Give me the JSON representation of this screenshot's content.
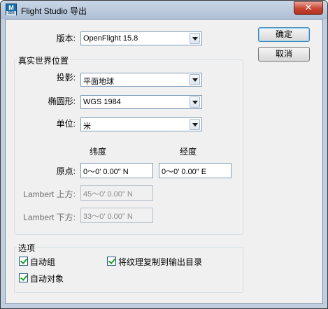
{
  "window": {
    "title": "Flight Studio 导出",
    "icon_text": "M",
    "icon_sub": "3DS",
    "close_glyph": "✕"
  },
  "version": {
    "label": "版本:",
    "value": "OpenFlight 15.8"
  },
  "buttons": {
    "ok": "确定",
    "cancel": "取消"
  },
  "real_world": {
    "title": "真实世界位置",
    "projection": {
      "label": "投影:",
      "value": "平面地球"
    },
    "ellipsoid": {
      "label": "椭圆形:",
      "value": "WGS 1984"
    },
    "units": {
      "label": "单位:",
      "value": "米"
    },
    "lat_header": "纬度",
    "lon_header": "经度",
    "origin": {
      "label": "原点:",
      "lat": "0～0' 0.00\" N",
      "lon": "0～0' 0.00\" E"
    },
    "lambert_upper": {
      "label": "Lambert 上方:",
      "value": "45～0' 0.00\" N"
    },
    "lambert_lower": {
      "label": "Lambert 下方:",
      "value": "33～0' 0.00\" N"
    }
  },
  "options": {
    "title": "选项",
    "auto_group": {
      "label": "自动组",
      "checked": true
    },
    "copy_textures": {
      "label": "将纹理复制到输出目录",
      "checked": true
    },
    "auto_object": {
      "label": "自动对象",
      "checked": true
    }
  }
}
